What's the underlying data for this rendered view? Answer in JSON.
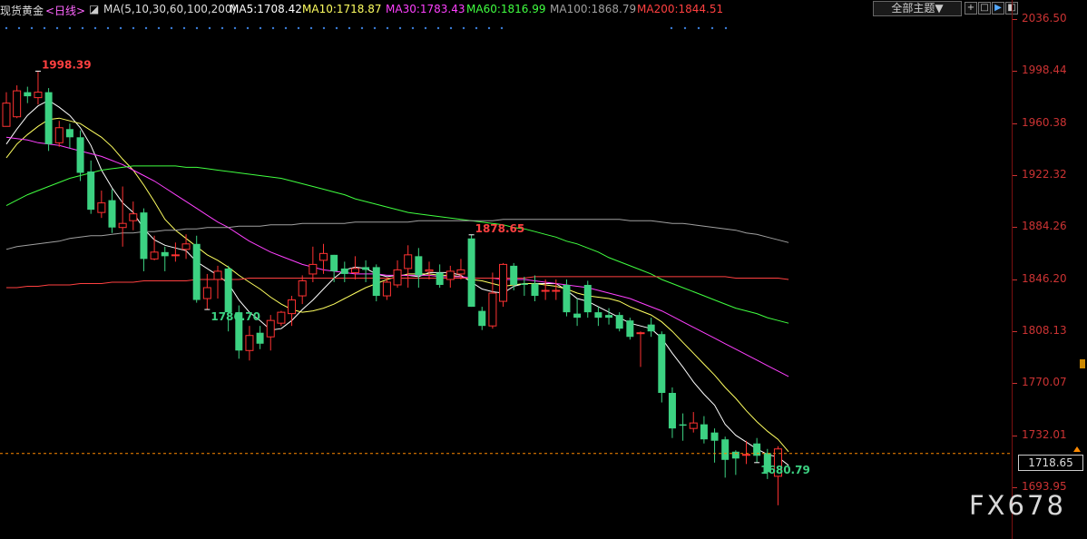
{
  "header": {
    "symbol": "现货黄金",
    "period": "<日线>",
    "ma_params": "MA(5,10,30,60,100,200)",
    "ma5": "MA5:1708.42",
    "ma10": "MA10:1718.87",
    "ma30": "MA30:1783.43",
    "ma60": "MA60:1816.99",
    "ma100": "MA100:1868.79",
    "ma200": "MA200:1844.51"
  },
  "toolbar": {
    "theme_label": "全部主题▼",
    "tools": [
      "+",
      "□",
      "▶",
      "◧"
    ]
  },
  "watermark": "FX678",
  "current_price_label": "1718.65",
  "colors": {
    "up": "#ff3232",
    "down": "#3cd282",
    "ma5": "#ffffff",
    "ma10": "#ffff60",
    "ma30": "#ff40ff",
    "ma60": "#40ff40",
    "ma100": "#a0a0a0",
    "ma200": "#ff4040",
    "axis": "#cc3333",
    "current": "#ff8a00"
  },
  "chart_data": {
    "type": "candlestick",
    "title": "",
    "y_ticks": [
      "2036.50",
      "1998.44",
      "1960.38",
      "1922.32",
      "1884.26",
      "1846.20",
      "1808.13",
      "1770.07",
      "1732.01",
      "1693.95"
    ],
    "ylim": [
      1655,
      2045
    ],
    "current_price": 1718.65,
    "annotations": [
      {
        "label": "1998.39",
        "type": "high",
        "index": 3
      },
      {
        "label": "1786.70",
        "type": "low",
        "index": 19
      },
      {
        "label": "1878.65",
        "type": "high",
        "index": 44
      },
      {
        "label": "1680.79",
        "type": "low",
        "index": 71
      }
    ],
    "candles": [
      [
        1958,
        1975,
        1960,
        1983
      ],
      [
        1965,
        1984,
        1964,
        1988
      ],
      [
        1983,
        1980,
        1975,
        1987
      ],
      [
        1979,
        1983,
        1974,
        1998.39
      ],
      [
        1983,
        1945,
        1940,
        1986
      ],
      [
        1946,
        1957,
        1943,
        1962
      ],
      [
        1956,
        1950,
        1942,
        1960
      ],
      [
        1950,
        1924,
        1918,
        1955
      ],
      [
        1925,
        1897,
        1894,
        1933
      ],
      [
        1895,
        1902,
        1891,
        1911
      ],
      [
        1904,
        1884,
        1880,
        1912
      ],
      [
        1884,
        1887,
        1870,
        1914
      ],
      [
        1889,
        1894,
        1882,
        1903
      ],
      [
        1895,
        1861,
        1852,
        1898
      ],
      [
        1861,
        1866,
        1860,
        1878
      ],
      [
        1866,
        1863,
        1852,
        1870
      ],
      [
        1864,
        1864,
        1859,
        1873
      ],
      [
        1868,
        1872,
        1861,
        1879
      ],
      [
        1872,
        1831,
        1829,
        1878
      ],
      [
        1832,
        1840,
        1824,
        1850
      ],
      [
        1846,
        1852,
        1832,
        1856
      ],
      [
        1854,
        1822,
        1808,
        1856
      ],
      [
        1822,
        1794,
        1788,
        1827
      ],
      [
        1794,
        1805,
        1786.7,
        1812
      ],
      [
        1807,
        1799,
        1795,
        1812
      ],
      [
        1804,
        1816,
        1794,
        1820
      ],
      [
        1814,
        1822,
        1812,
        1823
      ],
      [
        1821,
        1831,
        1812,
        1834
      ],
      [
        1834,
        1845,
        1828,
        1849
      ],
      [
        1850,
        1857,
        1844,
        1870
      ],
      [
        1860,
        1865,
        1850,
        1872
      ],
      [
        1864,
        1852,
        1844,
        1864
      ],
      [
        1854,
        1850,
        1844,
        1859
      ],
      [
        1851,
        1854,
        1846,
        1863
      ],
      [
        1855,
        1853,
        1844,
        1860
      ],
      [
        1855,
        1834,
        1830,
        1857
      ],
      [
        1834,
        1844,
        1831,
        1847
      ],
      [
        1842,
        1853,
        1840,
        1860
      ],
      [
        1854,
        1864,
        1840,
        1871
      ],
      [
        1863,
        1849,
        1840,
        1869
      ],
      [
        1852,
        1853,
        1846,
        1859
      ],
      [
        1851,
        1842,
        1840,
        1857
      ],
      [
        1846,
        1852,
        1840,
        1856
      ],
      [
        1850,
        1853,
        1846,
        1861
      ],
      [
        1876,
        1826,
        1826,
        1878.65
      ],
      [
        1823,
        1812,
        1809,
        1826
      ],
      [
        1812,
        1836,
        1810,
        1851
      ],
      [
        1830,
        1857,
        1826,
        1858
      ],
      [
        1856,
        1842,
        1838,
        1858
      ],
      [
        1843,
        1842,
        1834,
        1848
      ],
      [
        1843,
        1834,
        1830,
        1849
      ],
      [
        1838,
        1838,
        1831,
        1846
      ],
      [
        1838,
        1838,
        1831,
        1846
      ],
      [
        1842,
        1822,
        1819,
        1846
      ],
      [
        1821,
        1818,
        1812,
        1832
      ],
      [
        1842,
        1822,
        1818,
        1845
      ],
      [
        1822,
        1818,
        1812,
        1826
      ],
      [
        1820,
        1818,
        1813,
        1825
      ],
      [
        1820,
        1810,
        1808,
        1822
      ],
      [
        1816,
        1804,
        1802,
        1818
      ],
      [
        1807,
        1807,
        1782,
        1808
      ],
      [
        1813,
        1808,
        1804,
        1818
      ],
      [
        1806,
        1763,
        1756,
        1808
      ],
      [
        1763,
        1737,
        1730,
        1767
      ],
      [
        1740,
        1739,
        1728,
        1748
      ],
      [
        1737,
        1741,
        1734,
        1749
      ],
      [
        1740,
        1729,
        1726,
        1746
      ],
      [
        1734,
        1728,
        1712,
        1737
      ],
      [
        1729,
        1714,
        1701,
        1731
      ],
      [
        1720,
        1715,
        1703,
        1721
      ],
      [
        1718,
        1718,
        1711,
        1728
      ],
      [
        1726,
        1717,
        1712,
        1730
      ],
      [
        1719,
        1705,
        1700,
        1722
      ],
      [
        1702,
        1722,
        1680.79,
        1724
      ]
    ],
    "series": [
      {
        "name": "MA5",
        "values": [
          1945,
          1956,
          1966,
          1973,
          1977,
          1972,
          1966,
          1957,
          1944,
          1926,
          1913,
          1902,
          1895,
          1883,
          1875,
          1871,
          1869,
          1867,
          1859,
          1854,
          1849,
          1843,
          1831,
          1822,
          1816,
          1809,
          1810,
          1816,
          1824,
          1831,
          1839,
          1847,
          1853,
          1855,
          1854,
          1850,
          1848,
          1849,
          1849,
          1848,
          1851,
          1851,
          1851,
          1849,
          1844,
          1839,
          1837,
          1836,
          1841,
          1843,
          1843,
          1843,
          1843,
          1838,
          1832,
          1830,
          1826,
          1822,
          1818,
          1814,
          1812,
          1810,
          1803,
          1792,
          1782,
          1771,
          1762,
          1754,
          1740,
          1732,
          1727,
          1722,
          1718,
          1716,
          1710
        ]
      },
      {
        "name": "MA10",
        "values": [
          1935,
          1945,
          1952,
          1958,
          1963,
          1964,
          1962,
          1960,
          1955,
          1950,
          1943,
          1934,
          1926,
          1915,
          1903,
          1890,
          1882,
          1876,
          1870,
          1864,
          1860,
          1855,
          1849,
          1844,
          1839,
          1833,
          1828,
          1824,
          1822,
          1823,
          1825,
          1828,
          1832,
          1836,
          1840,
          1843,
          1846,
          1848,
          1850,
          1850,
          1850,
          1849,
          1849,
          1848,
          1846,
          1845,
          1843,
          1841,
          1842,
          1843,
          1843,
          1842,
          1841,
          1839,
          1836,
          1834,
          1833,
          1832,
          1830,
          1826,
          1823,
          1820,
          1815,
          1808,
          1800,
          1792,
          1784,
          1776,
          1767,
          1759,
          1750,
          1742,
          1735,
          1729,
          1720
        ]
      },
      {
        "name": "MA30",
        "values": [
          1950,
          1949,
          1948,
          1946,
          1945,
          1944,
          1942,
          1940,
          1938,
          1936,
          1933,
          1930,
          1926,
          1922,
          1918,
          1913,
          1908,
          1903,
          1898,
          1893,
          1888,
          1884,
          1879,
          1874,
          1870,
          1866,
          1863,
          1860,
          1857,
          1855,
          1853,
          1852,
          1851,
          1850,
          1850,
          1850,
          1849,
          1849,
          1849,
          1849,
          1849,
          1848,
          1848,
          1848,
          1847,
          1847,
          1847,
          1846,
          1846,
          1846,
          1845,
          1844,
          1843,
          1842,
          1841,
          1840,
          1838,
          1836,
          1834,
          1832,
          1829,
          1826,
          1823,
          1819,
          1815,
          1811,
          1807,
          1803,
          1799,
          1795,
          1791,
          1787,
          1783,
          1779,
          1775
        ]
      },
      {
        "name": "MA60",
        "values": [
          1900,
          1904,
          1908,
          1911,
          1914,
          1917,
          1920,
          1922,
          1924,
          1926,
          1927,
          1928,
          1929,
          1929,
          1929,
          1929,
          1929,
          1928,
          1928,
          1927,
          1926,
          1925,
          1924,
          1923,
          1922,
          1921,
          1920,
          1918,
          1916,
          1914,
          1912,
          1910,
          1908,
          1905,
          1903,
          1901,
          1899,
          1897,
          1895,
          1894,
          1893,
          1892,
          1891,
          1890,
          1889,
          1888,
          1887,
          1886,
          1884,
          1883,
          1881,
          1879,
          1877,
          1874,
          1872,
          1869,
          1866,
          1862,
          1859,
          1856,
          1853,
          1850,
          1846,
          1843,
          1840,
          1837,
          1834,
          1831,
          1828,
          1825,
          1823,
          1821,
          1818,
          1816,
          1814
        ]
      },
      {
        "name": "MA100",
        "values": [
          1868,
          1870,
          1871,
          1872,
          1873,
          1874,
          1876,
          1877,
          1878,
          1878,
          1879,
          1880,
          1880,
          1881,
          1881,
          1882,
          1882,
          1883,
          1883,
          1884,
          1884,
          1884,
          1885,
          1885,
          1885,
          1886,
          1886,
          1886,
          1887,
          1887,
          1887,
          1887,
          1887,
          1888,
          1888,
          1888,
          1888,
          1888,
          1888,
          1889,
          1889,
          1889,
          1889,
          1889,
          1889,
          1889,
          1889,
          1890,
          1890,
          1890,
          1890,
          1890,
          1890,
          1890,
          1890,
          1890,
          1890,
          1890,
          1890,
          1889,
          1889,
          1889,
          1888,
          1887,
          1887,
          1886,
          1885,
          1884,
          1883,
          1882,
          1880,
          1879,
          1877,
          1875,
          1873
        ]
      },
      {
        "name": "MA200",
        "values": [
          1840,
          1840,
          1841,
          1841,
          1842,
          1842,
          1842,
          1843,
          1843,
          1843,
          1844,
          1844,
          1844,
          1845,
          1845,
          1845,
          1845,
          1845,
          1846,
          1846,
          1846,
          1846,
          1846,
          1847,
          1847,
          1847,
          1847,
          1847,
          1847,
          1847,
          1847,
          1847,
          1847,
          1847,
          1847,
          1847,
          1847,
          1847,
          1847,
          1847,
          1847,
          1847,
          1847,
          1847,
          1847,
          1847,
          1847,
          1847,
          1847,
          1847,
          1848,
          1848,
          1848,
          1848,
          1848,
          1848,
          1848,
          1848,
          1848,
          1848,
          1848,
          1848,
          1848,
          1848,
          1848,
          1848,
          1848,
          1848,
          1848,
          1847,
          1847,
          1847,
          1847,
          1847,
          1846
        ]
      }
    ]
  }
}
